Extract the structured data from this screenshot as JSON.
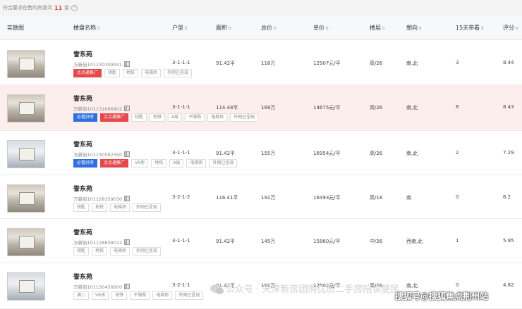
{
  "top": {
    "prefix": "符合要求在售的房源共",
    "count": "11",
    "suffix": "套",
    "help": "?"
  },
  "columns": [
    {
      "label": "实勘图",
      "sortable": false
    },
    {
      "label": "楼盘名称",
      "sortable": true
    },
    {
      "label": "户型",
      "sortable": true
    },
    {
      "label": "面积",
      "sortable": true
    },
    {
      "label": "总价",
      "sortable": true
    },
    {
      "label": "单价",
      "sortable": true
    },
    {
      "label": "楼层",
      "sortable": true
    },
    {
      "label": "朝向",
      "sortable": true
    },
    {
      "label": "15天带看",
      "sortable": true
    },
    {
      "label": "评分",
      "sortable": true
    }
  ],
  "sort_icon": "⇅",
  "rows": [
    {
      "title": "誉东苑",
      "code": "万新街101130309941",
      "tags": [
        {
          "t": "点点通推广",
          "k": "red"
        },
        {
          "t": "钥匙",
          "k": ""
        },
        {
          "t": "地铁",
          "k": ""
        },
        {
          "t": "电梯房",
          "k": ""
        },
        {
          "t": "外网已呈现",
          "k": ""
        }
      ],
      "layout": "3-1-1-1",
      "area": "91.42平",
      "total": "118万",
      "unit": "12907元/平",
      "floor": "高/26",
      "orient": "南,北",
      "views": "3",
      "score": "8.44"
    },
    {
      "title": "誉东苑",
      "code": "万新街101131666902",
      "tags": [
        {
          "t": "必看好房",
          "k": "blue"
        },
        {
          "t": "点点通推广",
          "k": "red"
        },
        {
          "t": "钥匙",
          "k": ""
        },
        {
          "t": "地铁",
          "k": ""
        },
        {
          "t": "A级",
          "k": ""
        },
        {
          "t": "不限购",
          "k": ""
        },
        {
          "t": "电梯房",
          "k": ""
        },
        {
          "t": "外网已呈现",
          "k": ""
        }
      ],
      "layout": "3-1-1-1",
      "area": "114.48平",
      "total": "168万",
      "unit": "14675元/平",
      "floor": "高/26",
      "orient": "南,北",
      "views": "6",
      "score": "8.43"
    },
    {
      "title": "誉东苑",
      "code": "万新街101130582350",
      "tags": [
        {
          "t": "必看好房",
          "k": "blue"
        },
        {
          "t": "点点通推广",
          "k": "red"
        },
        {
          "t": "VR房",
          "k": ""
        },
        {
          "t": "地铁",
          "k": ""
        },
        {
          "t": "A级",
          "k": ""
        },
        {
          "t": "电梯房",
          "k": ""
        },
        {
          "t": "外网已呈现",
          "k": ""
        }
      ],
      "layout": "3-1-1-1",
      "area": "91.42平",
      "total": "155万",
      "unit": "16954元/平",
      "floor": "高/26",
      "orient": "南,北",
      "views": "2",
      "score": "7.29"
    },
    {
      "title": "誉东苑",
      "code": "万新街101128159030",
      "tags": [
        {
          "t": "钥匙",
          "k": ""
        },
        {
          "t": "地铁",
          "k": ""
        },
        {
          "t": "电梯房",
          "k": ""
        },
        {
          "t": "外网已呈现",
          "k": ""
        }
      ],
      "layout": "3-2-1-2",
      "area": "116.41平",
      "total": "192万",
      "unit": "16493元/平",
      "floor": "高/18",
      "orient": "南",
      "views": "0",
      "score": "6.2"
    },
    {
      "title": "誉东苑",
      "code": "万新街101128838012",
      "tags": [
        {
          "t": "钥匙",
          "k": ""
        },
        {
          "t": "地铁",
          "k": ""
        },
        {
          "t": "电梯房",
          "k": ""
        },
        {
          "t": "外网已呈现",
          "k": ""
        }
      ],
      "layout": "3-1-1-1",
      "area": "91.42平",
      "total": "145万",
      "unit": "15860元/平",
      "floor": "中/26",
      "orient": "西南,北",
      "views": "1",
      "score": "5.95"
    },
    {
      "title": "誉东苑",
      "code": "万新街101130456600",
      "tags": [
        {
          "t": "满二",
          "k": ""
        },
        {
          "t": "VR房",
          "k": ""
        },
        {
          "t": "地铁",
          "k": ""
        },
        {
          "t": "不限购",
          "k": ""
        },
        {
          "t": "电梯房",
          "k": ""
        },
        {
          "t": "外网已呈现",
          "k": ""
        }
      ],
      "layout": "3-2-1-1",
      "area": "91.42平",
      "total": "160万",
      "unit": "17502元/平",
      "floor": "高/26",
      "orient": "南,北",
      "views": "0",
      "score": "4.82"
    }
  ],
  "watermark": {
    "left": "公众号 · 天津新房团购优质二手房陪读便民",
    "right": "搜狐号@搜狐焦点荆州站"
  }
}
